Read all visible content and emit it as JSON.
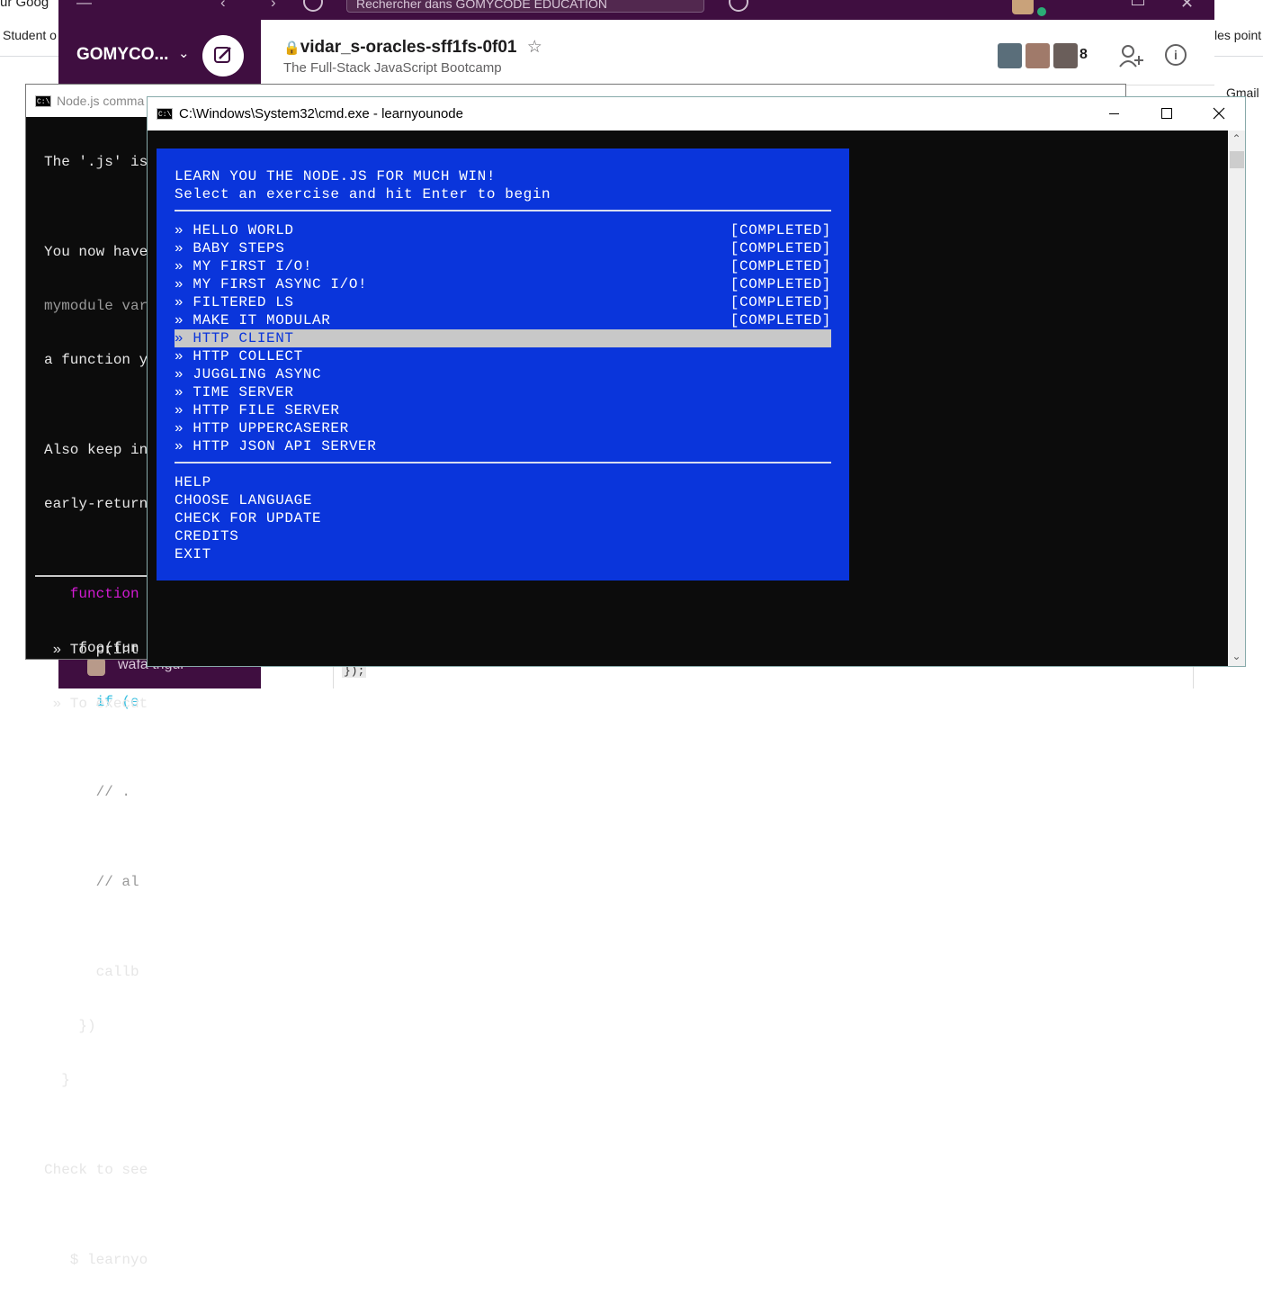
{
  "browser": {
    "tab_partial": "ur Goog",
    "bookmark_left_partial": "Student o",
    "bookmark_right_partial": "les point",
    "gmail_partial": "Gmail"
  },
  "slack": {
    "search_placeholder": "Rechercher dans GOMYCODE EDUCATION",
    "workspace_name": "GOMYCO...",
    "channel_name": "vidar_s-oracles-sff1fs-0f01",
    "channel_topic": "The Full-Stack JavaScript Bootcamp",
    "member_count": "8",
    "sidebar_user": "wafa trigui",
    "message_code": "});"
  },
  "back_window": {
    "title": "Node.js comma",
    "lines": [
      "The '.js' is",
      "",
      "You now have",
      "mymodule var",
      "a function y",
      "",
      "Also keep in",
      "early-return",
      "",
      "   function",
      "    foo(fun",
      "      if (e",
      "",
      "      // .",
      "",
      "      // al",
      "",
      "      callb",
      "    })",
      "  }",
      "",
      "Check to see",
      "",
      "   $ learnyo"
    ],
    "footer_lines": [
      " » To print",
      " » To execut"
    ]
  },
  "front_window": {
    "title": "C:\\Windows\\System32\\cmd.exe - learnyounode",
    "icon_text": "C:\\",
    "menu": {
      "heading": "LEARN YOU THE NODE.JS FOR MUCH WIN!",
      "subheading": "Select an exercise and hit Enter to begin",
      "exercises": [
        {
          "label": "» HELLO WORLD",
          "status": "[COMPLETED]"
        },
        {
          "label": "» BABY STEPS",
          "status": "[COMPLETED]"
        },
        {
          "label": "» MY FIRST I/O!",
          "status": "[COMPLETED]"
        },
        {
          "label": "» MY FIRST ASYNC I/O!",
          "status": "[COMPLETED]"
        },
        {
          "label": "» FILTERED LS",
          "status": "[COMPLETED]"
        },
        {
          "label": "» MAKE IT MODULAR",
          "status": "[COMPLETED]"
        },
        {
          "label": "» HTTP CLIENT",
          "status": ""
        },
        {
          "label": "» HTTP COLLECT",
          "status": ""
        },
        {
          "label": "» JUGGLING ASYNC",
          "status": ""
        },
        {
          "label": "» TIME SERVER",
          "status": ""
        },
        {
          "label": "» HTTP FILE SERVER",
          "status": ""
        },
        {
          "label": "» HTTP UPPERCASERER",
          "status": ""
        },
        {
          "label": "» HTTP JSON API SERVER",
          "status": ""
        }
      ],
      "selected": "» HTTP CLIENT",
      "options": [
        "HELP",
        "CHOOSE LANGUAGE",
        "CHECK FOR UPDATE",
        "CREDITS",
        "EXIT"
      ]
    },
    "colors": {
      "menu_bg": "#0a35db",
      "selection_bg": "#c8c8c8",
      "terminal_bg": "#0c0c0c"
    }
  }
}
